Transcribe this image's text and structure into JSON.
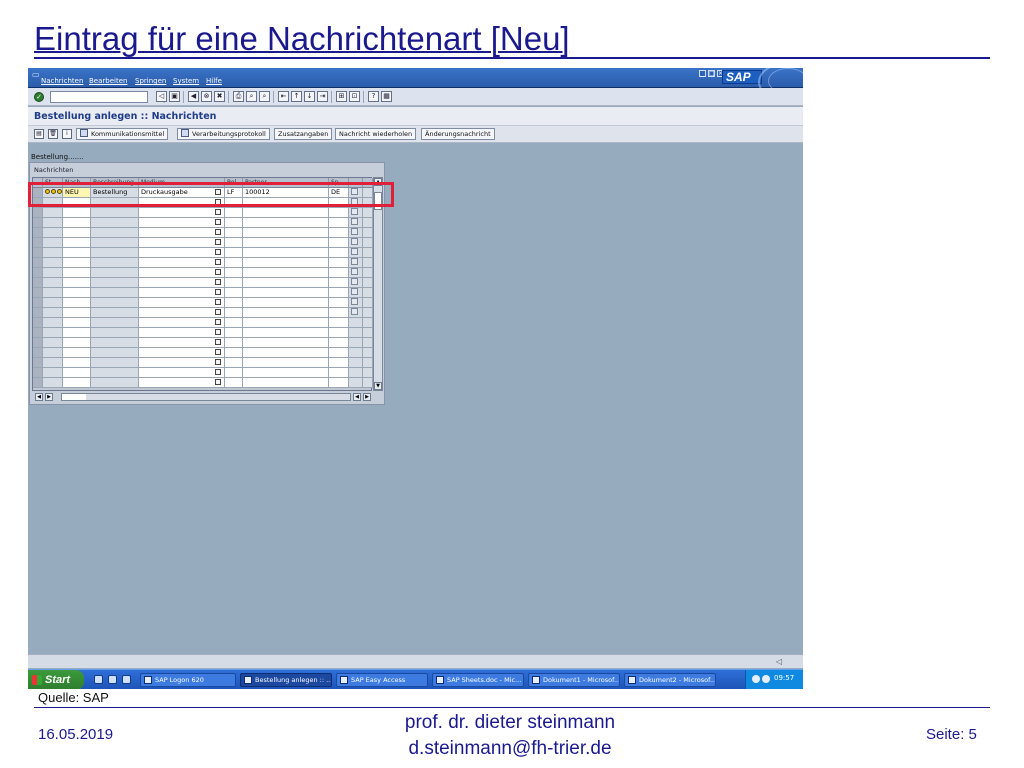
{
  "slide": {
    "title": "Eintrag für eine Nachrichtenart [Neu]",
    "source": "Quelle: SAP",
    "date": "16.05.2019",
    "author_line1": "prof. dr. dieter steinmann",
    "author_line2": "d.steinmann@fh-trier.de",
    "page": "Seite: 5"
  },
  "menubar": {
    "items": [
      "Nachrichten",
      "Bearbeiten",
      "Springen",
      "System",
      "Hilfe"
    ],
    "logo": "SAP"
  },
  "toolbar": {
    "command_field_value": ""
  },
  "screen": {
    "title": "Bestellung anlegen :: Nachrichten",
    "subtitle": "Bestellung.......",
    "table_caption": "Nachrichten"
  },
  "app_toolbar": {
    "buttons": [
      "Kommunikationsmittel",
      "Verarbeitungsprotokoll",
      "Zusatzangaben",
      "Nachricht wiederholen",
      "Änderungsnachricht"
    ]
  },
  "table": {
    "columns": [
      "St..",
      "Nach..",
      "Beschreibung",
      "Medium",
      "Rol",
      "Partner",
      "Sp..",
      "..",
      "..."
    ],
    "rows": [
      {
        "status": "",
        "type": "NEU",
        "description": "Bestellung",
        "medium": "Druckausgabe",
        "role": "LF",
        "partner": "100012",
        "language": "DE"
      }
    ],
    "empty_rows": 19
  },
  "statusbar": {
    "right": "◁"
  },
  "taskbar": {
    "start": "Start",
    "tasks": [
      "SAP Logon 620",
      "Bestellung anlegen :: ...",
      "SAP Easy Access",
      "SAP Sheets.doc - Mic...",
      "Dokument1 - Microsof...",
      "Dokument2 - Microsof..."
    ],
    "clock": "09:57"
  },
  "colors": {
    "title_blue": "#1a1a8e",
    "highlight_red": "#e02038",
    "sap_background": "#96abbd"
  }
}
